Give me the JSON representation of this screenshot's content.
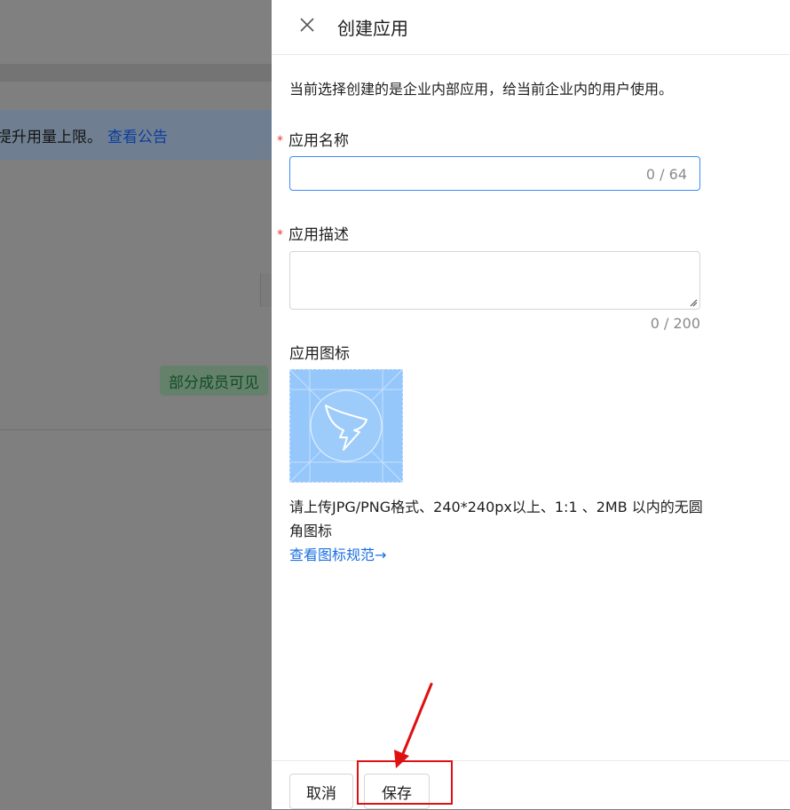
{
  "background": {
    "notice_text": "提升用量上限。",
    "notice_link": "查看公告",
    "badge": "部分成员可见"
  },
  "drawer": {
    "title": "创建应用",
    "intro": "当前选择创建的是企业内部应用，给当前企业内的用户使用。",
    "fields": {
      "name": {
        "required_mark": "*",
        "label": "应用名称",
        "value": "",
        "counter": "0 / 64"
      },
      "description": {
        "required_mark": "*",
        "label": "应用描述",
        "value": "",
        "counter": "0 / 200"
      },
      "icon": {
        "label": "应用图标",
        "hint": "请上传JPG/PNG格式、240*240px以上、1:1 、2MB 以内的无圆角图标",
        "link": "查看图标规范→"
      }
    },
    "footer": {
      "cancel_label": "取消",
      "save_label": "保存"
    }
  },
  "colors": {
    "accent": "#3d8bf5",
    "link": "#1a6fe0",
    "required": "#e53935",
    "annotation": "#e01010",
    "icon_bg": "#96c7fb"
  }
}
